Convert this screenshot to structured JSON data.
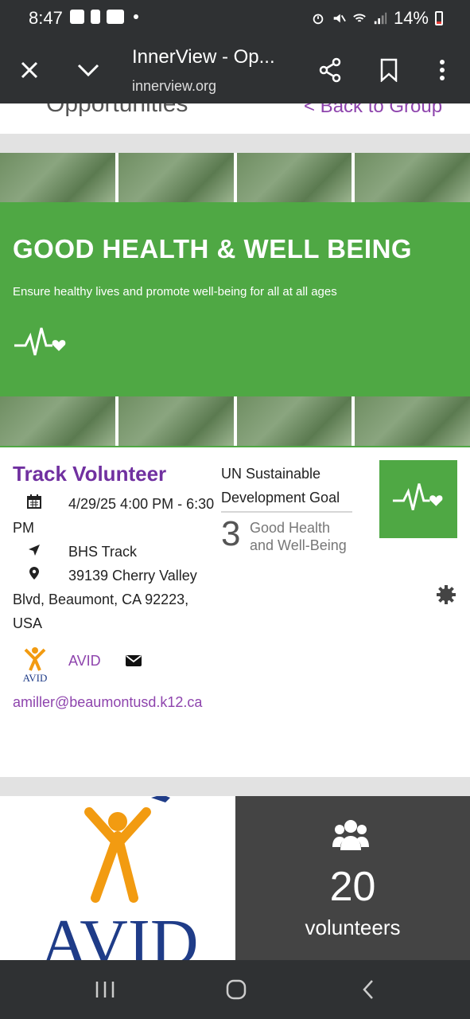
{
  "status_bar": {
    "time": "8:47",
    "battery": "14%",
    "icons": [
      "gallery-icon",
      "alert-icon",
      "youtube-icon",
      "alarm-icon",
      "mute-icon",
      "wifi-icon",
      "signal-icon",
      "battery-icon"
    ]
  },
  "browser": {
    "title": "InnerView - Op...",
    "url": "innerview.org",
    "icons": [
      "close-icon",
      "chevron-down-icon",
      "share-icon",
      "bookmark-icon",
      "more-icon"
    ]
  },
  "page_header": {
    "title": "Opportunities",
    "back_link": "< Back to Group"
  },
  "banner": {
    "title": "GOOD HEALTH & WELL BEING",
    "subtitle": "Ensure healthy lives and promote well-being for all at all ages",
    "color": "#4fa844"
  },
  "event": {
    "title": "Track Volunteer",
    "datetime": "4/29/25 4:00 PM - 6:30 PM",
    "location_name": "BHS Track",
    "address": "39139 Cherry Valley Blvd, Beaumont, CA 92223, USA",
    "org_name": "AVID",
    "email": "amiller@beaumontusd.k12.ca",
    "accent_color": "#7030a0",
    "link_color": "#8e44ad"
  },
  "sdg": {
    "heading": "UN Sustainable Development Goal",
    "number": "3",
    "name": "Good Health and Well-Being"
  },
  "volunteers": {
    "count": "20",
    "label": "volunteers"
  },
  "logo": {
    "text": "AVID"
  },
  "nav_bar": {
    "icons": [
      "recent-apps-icon",
      "home-icon",
      "back-icon"
    ]
  }
}
